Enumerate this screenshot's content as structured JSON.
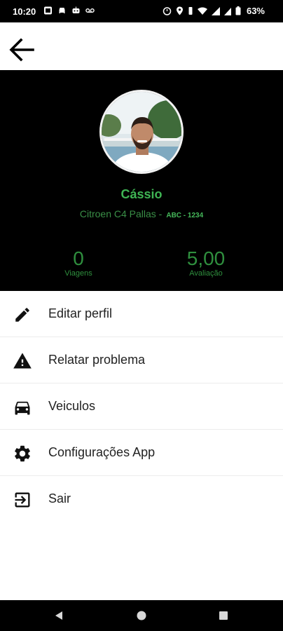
{
  "status_bar": {
    "time": "10:20",
    "battery": "63%"
  },
  "profile": {
    "name": "Cássio",
    "vehicle": "Citroen C4 Pallas -",
    "plate": "ABC - 1234",
    "stats": [
      {
        "value": "0",
        "label": "Viagens"
      },
      {
        "value": "5,00",
        "label": "Avaliação"
      }
    ]
  },
  "menu": {
    "items": [
      {
        "label": "Editar perfil",
        "icon": "pencil-icon"
      },
      {
        "label": "Relatar problema",
        "icon": "warning-icon"
      },
      {
        "label": "Veiculos",
        "icon": "car-icon"
      },
      {
        "label": "Configurações App",
        "icon": "gear-icon"
      },
      {
        "label": "Sair",
        "icon": "exit-icon"
      }
    ]
  },
  "colors": {
    "accent_green": "#3fb454",
    "header_bg": "#000000"
  }
}
